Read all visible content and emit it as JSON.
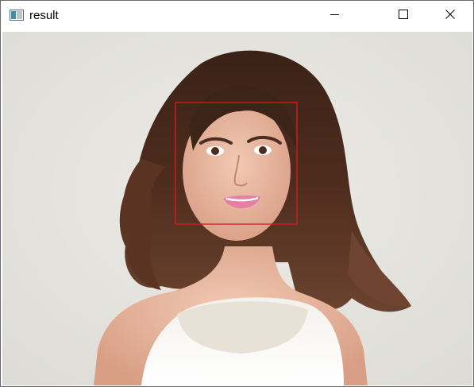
{
  "window": {
    "title": "result",
    "icon": "image-window-icon"
  },
  "controls": {
    "minimize_icon": "minimize-icon",
    "maximize_icon": "maximize-icon",
    "close_icon": "close-icon"
  },
  "image": {
    "subject": "portrait-photo",
    "detection_box_color": "#e0191c",
    "background_color": "#e6e5e0"
  }
}
